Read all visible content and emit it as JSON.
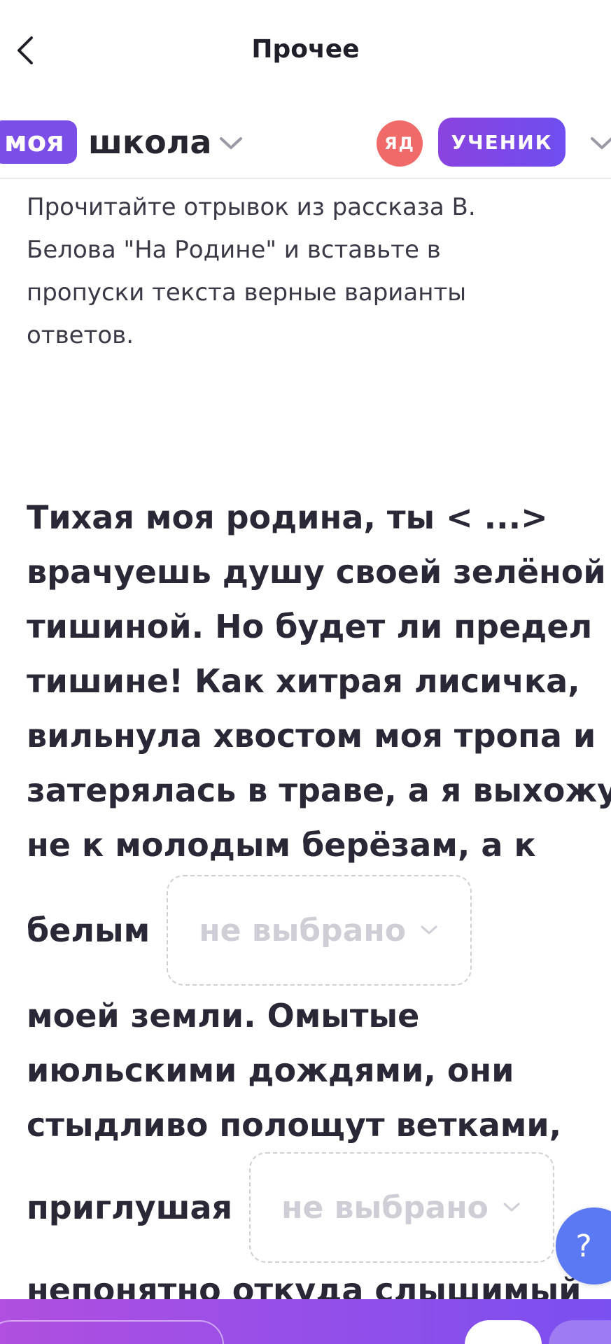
{
  "nav": {
    "title": "Прочее"
  },
  "header": {
    "logo_part1": "моя",
    "logo_part2": "школа",
    "avatar_initials": "ЯД",
    "role_label": "УЧЕНИК"
  },
  "task": {
    "instruction": "Прочитайте отрывок из рассказа В. Белова \"На Родине\" и вставьте в пропуски текста верные варианты ответов.",
    "passage_lines": [
      "Тихая моя родина, ты < ...>",
      "врачуешь душу своей зелёной",
      "тишиной. Но будет ли предел",
      "тишине! Как хитрая лисичка,",
      "вильнула хвостом моя тропа и",
      "затерялась в траве, а я выхожу",
      "не к молодым берёзам, а к"
    ],
    "gap1_before": "белым",
    "dropdown_placeholder": "не выбрано",
    "after_gap1_lines": [
      "моей земли. Омытые",
      "июльскими дождями, они",
      "стыдливо полощут ветками,"
    ],
    "gap2_before": "приглушая",
    "gap2_after": ",",
    "last_line": "непонятно откуда слышимый"
  },
  "help": {
    "label": "?"
  },
  "colors": {
    "brand": "#7b4ee8",
    "avatar": "#ef6a68",
    "help": "#5b79f2"
  }
}
